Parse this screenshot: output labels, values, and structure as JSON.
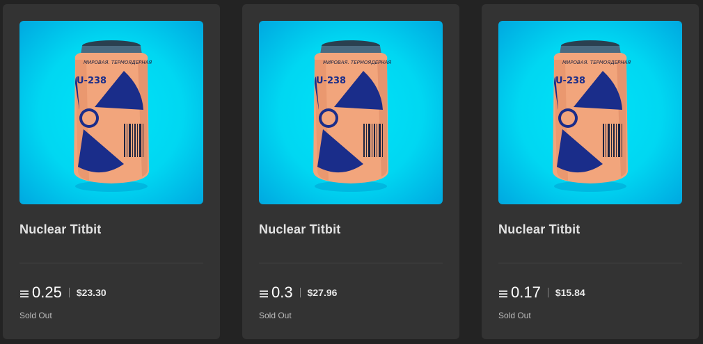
{
  "products": [
    {
      "name": "Nuclear Titbit",
      "price_crypto": "0.25",
      "price_fiat": "$23.30",
      "status": "Sold Out",
      "can_label_top": "МИРОВАЯ. ТЕРМОЯДЕРНАЯ",
      "can_label_main": "U-238",
      "image_icon": "radiation-can-image"
    },
    {
      "name": "Nuclear Titbit",
      "price_crypto": "0.3",
      "price_fiat": "$27.96",
      "status": "Sold Out",
      "can_label_top": "МИРОВАЯ. ТЕРМОЯДЕРНАЯ",
      "can_label_main": "U-238",
      "image_icon": "radiation-can-image"
    },
    {
      "name": "Nuclear Titbit",
      "price_crypto": "0.17",
      "price_fiat": "$15.84",
      "status": "Sold Out",
      "can_label_top": "МИРОВАЯ. ТЕРМОЯДЕРНАЯ",
      "can_label_main": "U-238",
      "image_icon": "radiation-can-image"
    }
  ],
  "currency_icon": "eth-icon",
  "colors": {
    "page_bg": "#232323",
    "card_bg": "#333333",
    "image_bg": "#00dcf5",
    "can_body": "#f2a57c",
    "radiation": "#1a2d8a"
  }
}
